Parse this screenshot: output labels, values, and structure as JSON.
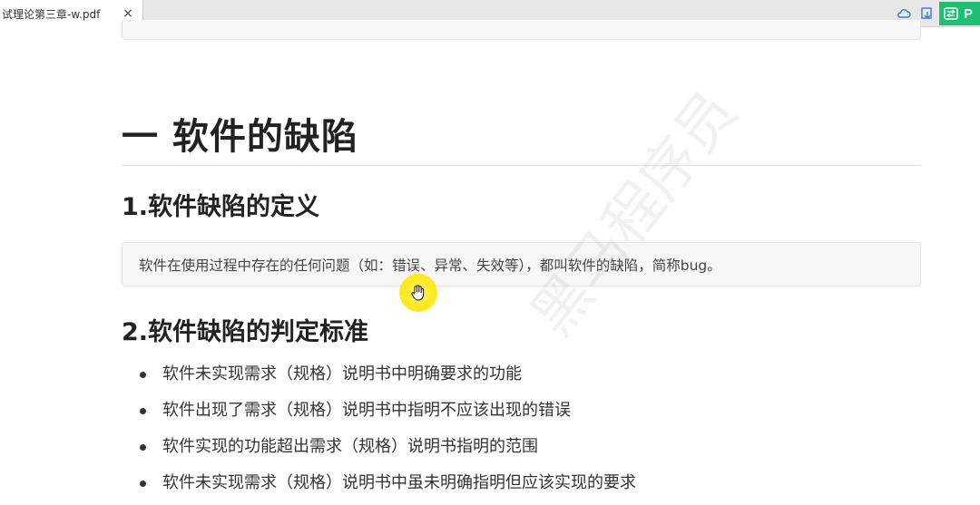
{
  "tab": {
    "title": "试理论第三章-w.pdf",
    "close_glyph": "×"
  },
  "toolbar": {
    "cloud_icon": "cloud-icon",
    "save_icon": "save-to-device-icon",
    "app_icon": "pdf-app-icon",
    "app_letter": "P"
  },
  "document": {
    "h1": "一 软件的缺陷",
    "section1": {
      "heading": "1.软件缺陷的定义",
      "quote": "软件在使用过程中存在的任何问题（如：错误、异常、失效等），都叫软件的缺陷，简称bug。"
    },
    "section2": {
      "heading": "2.软件缺陷的判定标准",
      "items": [
        "软件未实现需求（规格）说明书中明确要求的功能",
        "软件出现了需求（规格）说明书中指明不应该出现的错误",
        "软件实现的功能超出需求（规格）说明书指明的范围",
        "软件未实现需求（规格）说明书中虽未明确指明但应该实现的要求"
      ]
    }
  },
  "watermark": "黑马程序员",
  "colors": {
    "app_accent": "#1cbf73",
    "cursor_highlight": "#ffe81a"
  }
}
